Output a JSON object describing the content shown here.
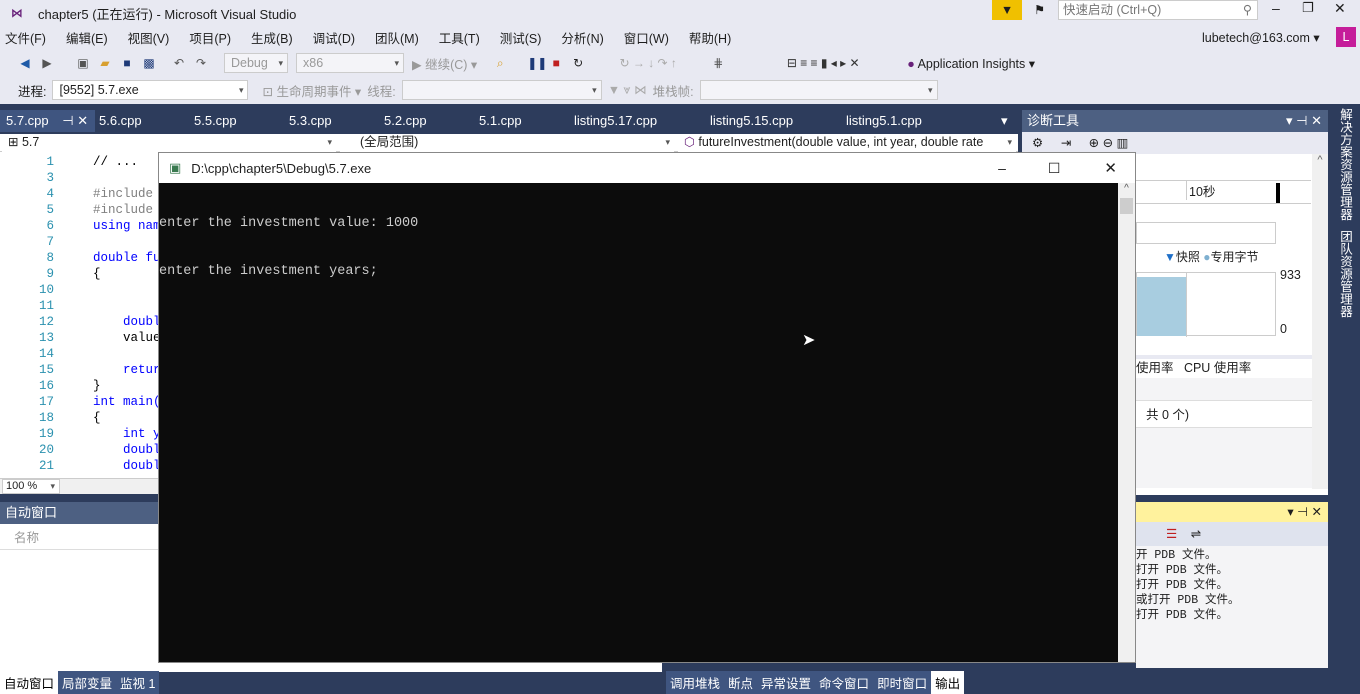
{
  "window": {
    "title": "chapter5 (正在运行) - Microsoft Visual Studio",
    "quick_launch_placeholder": "快速启动 (Ctrl+Q)",
    "account": "lubetech@163.com",
    "avatar_letter": "L"
  },
  "menu": [
    "文件(F)",
    "编辑(E)",
    "视图(V)",
    "项目(P)",
    "生成(B)",
    "调试(D)",
    "团队(M)",
    "工具(T)",
    "测试(S)",
    "分析(N)",
    "窗口(W)",
    "帮助(H)"
  ],
  "toolbar": {
    "config": "Debug",
    "platform": "x86",
    "continue": "继续(C)",
    "app_insights": "Application Insights"
  },
  "debug_toolbar": {
    "process_label": "进程:",
    "process_value": "[9552] 5.7.exe",
    "lifecycle": "生命周期事件",
    "thread_label": "线程:",
    "stackframe_label": "堆栈帧:"
  },
  "tabs": [
    "5.7.cpp",
    "5.6.cpp",
    "5.5.cpp",
    "5.3.cpp",
    "5.2.cpp",
    "5.1.cpp",
    "listing5.17.cpp",
    "listing5.15.cpp",
    "listing5.1.cpp"
  ],
  "navbar": {
    "project": "5.7",
    "scope": "(全局范围)",
    "member": "futureInvestment(double value, int year, double rate"
  },
  "editor": {
    "lines": [
      {
        "n": "1",
        "t": "// ..."
      },
      {
        "n": "3",
        "t": ""
      },
      {
        "n": "4",
        "t": "#include"
      },
      {
        "n": "5",
        "t": "#include"
      },
      {
        "n": "6",
        "t": "using name"
      },
      {
        "n": "7",
        "t": ""
      },
      {
        "n": "8",
        "t": "double fu"
      },
      {
        "n": "9",
        "t": "{"
      },
      {
        "n": "10",
        "t": ""
      },
      {
        "n": "11",
        "t": ""
      },
      {
        "n": "12",
        "t": "    double"
      },
      {
        "n": "13",
        "t": "    value"
      },
      {
        "n": "14",
        "t": ""
      },
      {
        "n": "15",
        "t": "    return"
      },
      {
        "n": "16",
        "t": "}"
      },
      {
        "n": "17",
        "t": "int main()"
      },
      {
        "n": "18",
        "t": "{"
      },
      {
        "n": "19",
        "t": "    int ye"
      },
      {
        "n": "20",
        "t": "    double"
      },
      {
        "n": "21",
        "t": "    double"
      }
    ],
    "zoom": "100 %"
  },
  "console": {
    "title": "D:\\cpp\\chapter5\\Debug\\5.7.exe",
    "lines": [
      "enter the investment value: 1000",
      "enter the investment years;"
    ]
  },
  "diagnostics": {
    "title": "诊断工具",
    "time_label": "10秒",
    "legend_snapshot": "快照",
    "legend_private": "专用字节",
    "y_max": "933",
    "y_min": "0",
    "tabs_partial": "使用率",
    "cpu_tab": "CPU 使用率",
    "count_text": "共 0 个)"
  },
  "output": {
    "lines": [
      "开 PDB 文件。",
      "打开 PDB 文件。",
      "打开 PDB 文件。",
      "或打开 PDB 文件。",
      "打开 PDB 文件。"
    ]
  },
  "auto_window": {
    "title": "自动窗口",
    "column": "名称"
  },
  "bottom_tabs_left": [
    "自动窗口",
    "局部变量",
    "监视 1"
  ],
  "bottom_tabs_right": [
    "调用堆栈",
    "断点",
    "异常设置",
    "命令窗口",
    "即时窗口",
    "输出"
  ],
  "side_tabs": [
    "解决方案资源管理器",
    "团队资源管理器"
  ],
  "colors": {
    "accent": "#68217a",
    "chrome": "#e8e9f2",
    "dark": "#2d3c5c",
    "filter": "#f0c000",
    "output_header": "#fff29d"
  }
}
